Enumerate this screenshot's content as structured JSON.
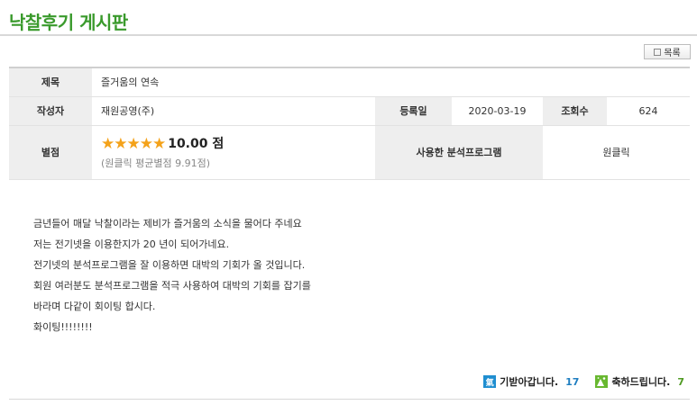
{
  "board": {
    "title": "낙찰후기 게시판"
  },
  "toolbar": {
    "list_label": "목록"
  },
  "info": {
    "subject_label": "제목",
    "subject": "즐거움의 연속",
    "author_label": "작성자",
    "author": "재원공영(주)",
    "date_label": "등록일",
    "date": "2020-03-19",
    "views_label": "조회수",
    "views": "624",
    "rating_label": "별점",
    "stars": "★★★★★",
    "rating": "10.00 점",
    "rating_avg": "(원클릭 평균별점 9.91점)",
    "program_label": "사용한 분석프로그램",
    "program": "원클릭"
  },
  "content": {
    "lines": [
      "금년들어 매달 낙찰이라는 제비가 즐거움의 소식을 물어다 주네요",
      "저는 전기넷을 이용한지가 20 년이 되어가네요.",
      "전기넷의 분석프로그램을 잘 이용하면 대박의 기회가 올 것입니다.",
      "회원 여러분도 분석프로그램을 적극 사용하여 대박의 기회를 잡기를",
      "바라며 다같이 회이팅 합시다.",
      "화이팅!!!!!!!!"
    ]
  },
  "reactions": {
    "cheer_badge": "氣",
    "cheer_label": "기받아갑니다.",
    "cheer_count": "17",
    "congrats_label": "축하드립니다.",
    "congrats_count": "7"
  }
}
